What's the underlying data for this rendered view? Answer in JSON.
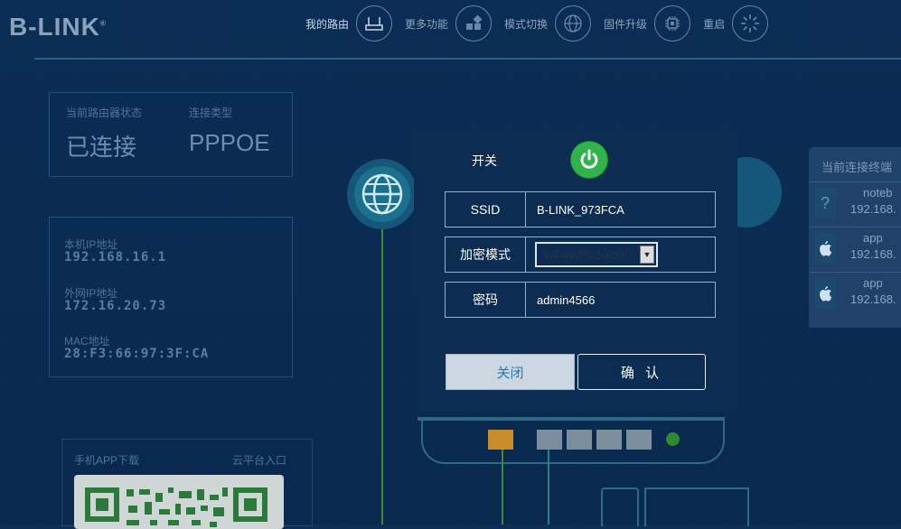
{
  "brand": "B-LINK",
  "nav": [
    {
      "label": "我的路由",
      "icon": "router-icon"
    },
    {
      "label": "更多功能",
      "icon": "grid-icon"
    },
    {
      "label": "模式切换",
      "icon": "globe-icon"
    },
    {
      "label": "固件升级",
      "icon": "chip-icon"
    },
    {
      "label": "重启",
      "icon": "restart-icon"
    }
  ],
  "status": {
    "router_state_label": "当前路由器状态",
    "router_state": "已连接",
    "conn_type_label": "连接类型",
    "conn_type": "PPPOE"
  },
  "network": {
    "local_ip_label": "本机IP地址",
    "local_ip": "192.168.16.1",
    "wan_ip_label": "外网IP地址",
    "wan_ip": "172.16.20.73",
    "mac_label": "MAC地址",
    "mac": "28:F3:66:97:3F:CA"
  },
  "clients": {
    "title": "当前连接终端",
    "items": [
      {
        "name": "noteb",
        "ip": "192.168."
      },
      {
        "name": "app",
        "ip": "192.168."
      },
      {
        "name": "app",
        "ip": "192.168."
      }
    ]
  },
  "app": {
    "download_label": "手机APP下载",
    "cloud_label": "云平台入口"
  },
  "dialog": {
    "switch_label": "开关",
    "ssid_label": "SSID",
    "ssid_value": "B-LINK_973FCA",
    "enc_label": "加密模式",
    "enc_value": "WPAWPA2-PSK",
    "pwd_label": "密码",
    "pwd_value": "admin4566",
    "close_label": "关闭",
    "ok_label": "确 认"
  },
  "colors": {
    "power_on": "#2fb34a",
    "background": "#0e2f55",
    "dialog_bg": "#0c2c52"
  }
}
